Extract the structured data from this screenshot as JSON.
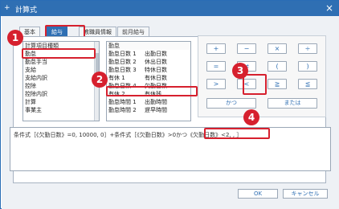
{
  "window": {
    "title": "計算式",
    "app_icon": "+",
    "close_label": "×"
  },
  "tabs": [
    "基本",
    "給与",
    "教職員情報",
    "前月給与"
  ],
  "left_list": {
    "header": "計算項目種類",
    "items": [
      "勤怠",
      "勤怠手当",
      "支給",
      "支給内訳",
      "控除",
      "控除内訳",
      "計算",
      "事業主"
    ]
  },
  "mid_list": {
    "header": "勤怠",
    "rows": [
      [
        "勤怠日数 1",
        "出勤日数"
      ],
      [
        "勤怠日数 2",
        "休出日数"
      ],
      [
        "勤怠日数 3",
        "特休日数"
      ],
      [
        "有休 1",
        "有休日数"
      ],
      [
        "勤怠日数 4",
        "欠勤日数"
      ],
      [
        "有休 2",
        "有休残"
      ],
      [
        "勤怠時間 1",
        "出勤時間"
      ],
      [
        "勤怠時間 2",
        "遅早時間"
      ]
    ]
  },
  "operators": {
    "row1": [
      "+",
      "−",
      "×",
      "÷"
    ],
    "row2": [
      "=",
      "≠",
      "(",
      ")"
    ],
    "row3": [
      ">",
      "<",
      "≧",
      "≦"
    ],
    "and_label": "かつ",
    "or_label": "または"
  },
  "formula": "条件式［《欠勤日数》=0, 10000, 0］+条件式［《欠勤日数》>0かつ《欠勤日数》<2, , ］",
  "footer": {
    "ok": "OK",
    "cancel": "キャンセル"
  },
  "badges": [
    "1",
    "2",
    "3",
    "4"
  ]
}
